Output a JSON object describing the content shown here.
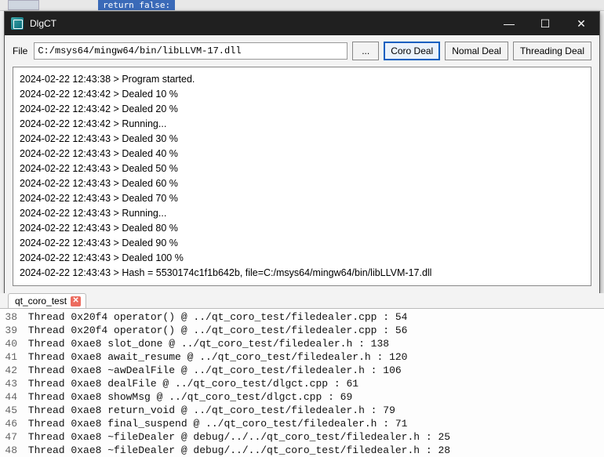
{
  "stray": {
    "code_fragment": "return false:"
  },
  "window": {
    "title": "DlgCT",
    "controls": {
      "min": "—",
      "max": "☐",
      "close": "✕"
    }
  },
  "toolbar": {
    "file_label": "File",
    "path_value": "C:/msys64/mingw64/bin/libLLVM-17.dll",
    "browse_label": "...",
    "coro_label": "Coro Deal",
    "normal_label": "Nomal Deal",
    "threading_label": "Threading Deal"
  },
  "log": [
    "2024-02-22 12:43:38 > Program started.",
    "2024-02-22 12:43:42 > Dealed 10 %",
    "2024-02-22 12:43:42 > Dealed 20 %",
    "2024-02-22 12:43:42 > Running...",
    "2024-02-22 12:43:43 > Dealed 30 %",
    "2024-02-22 12:43:43 > Dealed 40 %",
    "2024-02-22 12:43:43 > Dealed 50 %",
    "2024-02-22 12:43:43 > Dealed 60 %",
    "2024-02-22 12:43:43 > Dealed 70 %",
    "2024-02-22 12:43:43 > Running...",
    "2024-02-22 12:43:43 > Dealed 80 %",
    "2024-02-22 12:43:43 > Dealed 90 %",
    "2024-02-22 12:43:43 > Dealed 100 %",
    "2024-02-22 12:43:43 > Hash = 5530174c1f1b642b, file=C:/msys64/mingw64/bin/libLLVM-17.dll"
  ],
  "console": {
    "tab_label": "qt_coro_test",
    "lines": [
      {
        "n": "38",
        "t": "Thread 0x20f4 operator() @ ../qt_coro_test/filedealer.cpp : 54"
      },
      {
        "n": "39",
        "t": "Thread 0x20f4 operator() @ ../qt_coro_test/filedealer.cpp : 56"
      },
      {
        "n": "40",
        "t": "Thread 0xae8 slot_done @ ../qt_coro_test/filedealer.h : 138"
      },
      {
        "n": "41",
        "t": "Thread 0xae8 await_resume @ ../qt_coro_test/filedealer.h : 120"
      },
      {
        "n": "42",
        "t": "Thread 0xae8 ~awDealFile @ ../qt_coro_test/filedealer.h : 106"
      },
      {
        "n": "43",
        "t": "Thread 0xae8 dealFile @ ../qt_coro_test/dlgct.cpp : 61"
      },
      {
        "n": "44",
        "t": "Thread 0xae8 showMsg @ ../qt_coro_test/dlgct.cpp : 69"
      },
      {
        "n": "45",
        "t": "Thread 0xae8 return_void @ ../qt_coro_test/filedealer.h : 79"
      },
      {
        "n": "46",
        "t": "Thread 0xae8 final_suspend @ ../qt_coro_test/filedealer.h : 71"
      },
      {
        "n": "47",
        "t": "Thread 0xae8 ~fileDealer @ debug/../../qt_coro_test/filedealer.h : 25"
      },
      {
        "n": "48",
        "t": "Thread 0xae8 ~fileDealer @ debug/../../qt_coro_test/filedealer.h : 28"
      }
    ]
  }
}
